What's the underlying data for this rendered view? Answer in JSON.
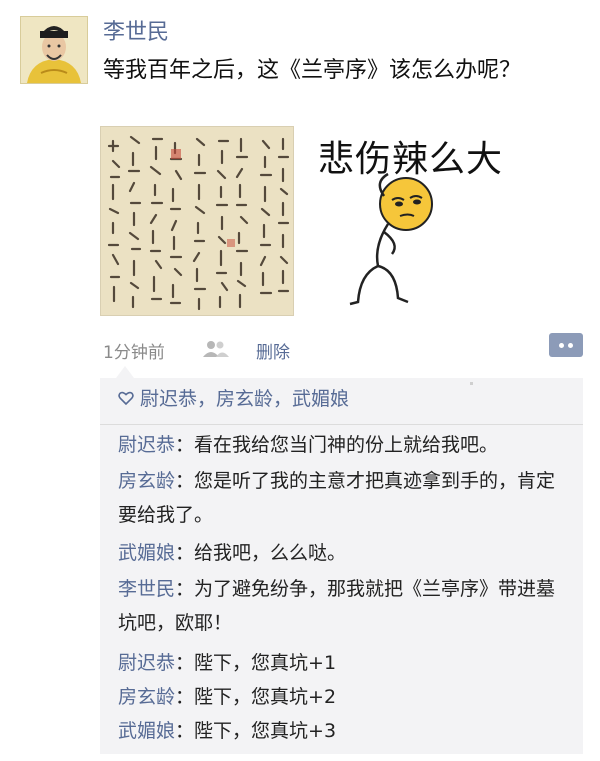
{
  "post": {
    "username": "李世民",
    "text": "等我百年之后，这《兰亭序》该怎么办呢？",
    "meme_caption": "悲伤辣么大",
    "timestamp": "1分钟前",
    "delete_label": "删除"
  },
  "likes": {
    "names": "尉迟恭，房玄龄，武媚娘"
  },
  "comments": [
    {
      "author": "尉迟恭",
      "separator": "：",
      "text": "看在我给您当门神的份上就给我吧。"
    },
    {
      "author": "房玄龄",
      "separator": "：",
      "text": "您是听了我的主意才把真迹拿到手的，肯定要给我了。"
    },
    {
      "author": "武媚娘",
      "separator": "：",
      "text": "给我吧，么么哒。"
    },
    {
      "author": "李世民",
      "separator": "：",
      "text": "为了避免纷争，那我就把《兰亭序》带进墓坑吧，欧耶！"
    },
    {
      "author": "尉迟恭",
      "separator": "：",
      "text": "陛下，您真坑+1"
    },
    {
      "author": "房玄龄",
      "separator": "：",
      "text": "陛下，您真坑+2"
    },
    {
      "author": "武媚娘",
      "separator": "：",
      "text": "陛下，您真坑+3"
    }
  ],
  "colors": {
    "link_blue": "#576b95",
    "panel_bg": "#f3f3f5"
  },
  "icons": {
    "avatar": "emperor-portrait",
    "calligraphy": "calligraphy-scroll-image",
    "meme": "stick-figure-meme",
    "friends": "friends-icon",
    "comment": "comment-dots-icon",
    "like": "heart-outline-icon"
  }
}
